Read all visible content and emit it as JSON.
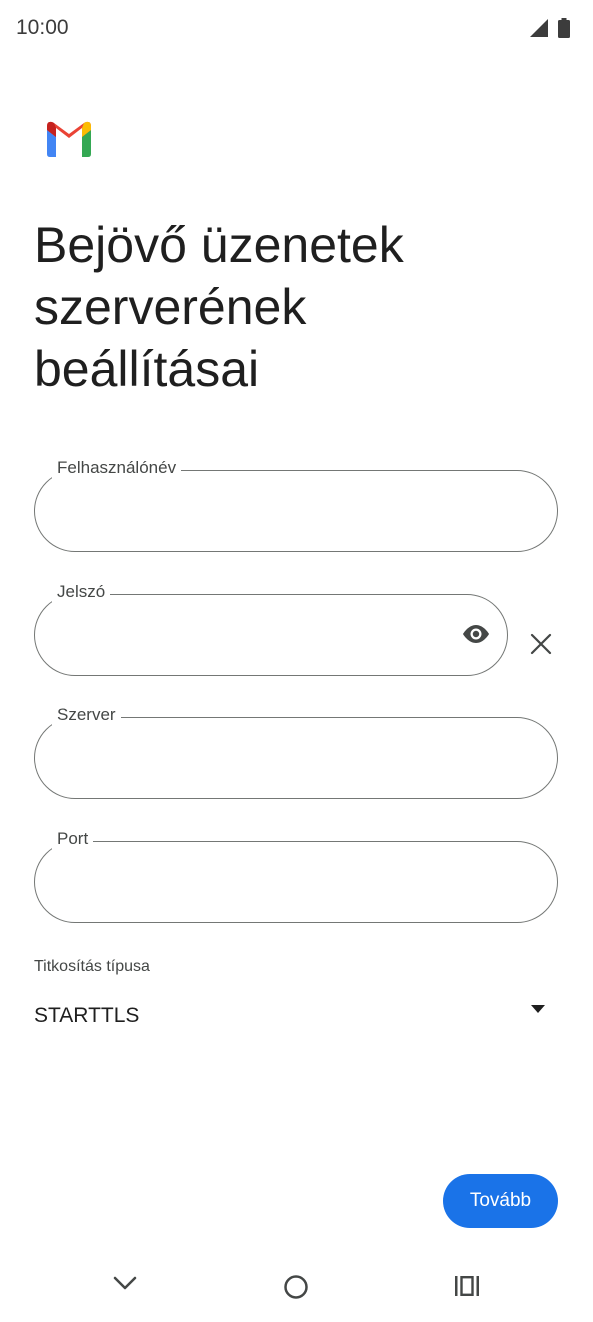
{
  "status_bar": {
    "time": "10:00"
  },
  "app": {
    "logo": "gmail-logo"
  },
  "page": {
    "title": "Bejövő üzenetek\nszerverének\nbeállításai"
  },
  "form": {
    "username": {
      "label": "Felhasználónév",
      "value": ""
    },
    "password": {
      "label": "Jelszó",
      "value": "",
      "visibility_icon": "eye-icon",
      "clear_icon": "close-icon"
    },
    "server": {
      "label": "Szerver",
      "value": ""
    },
    "port": {
      "label": "Port",
      "value": ""
    },
    "encryption": {
      "label": "Titkosítás típusa",
      "selected": "STARTTLS",
      "icon": "dropdown-arrow-icon"
    }
  },
  "actions": {
    "next_label": "Tovább"
  },
  "colors": {
    "accent": "#1a73e8",
    "outline": "#747775",
    "text": "#1f1f1f"
  },
  "nav": {
    "back_icon": "chevron-down-icon",
    "home_icon": "home-circle-icon",
    "recent_icon": "recents-icon"
  }
}
